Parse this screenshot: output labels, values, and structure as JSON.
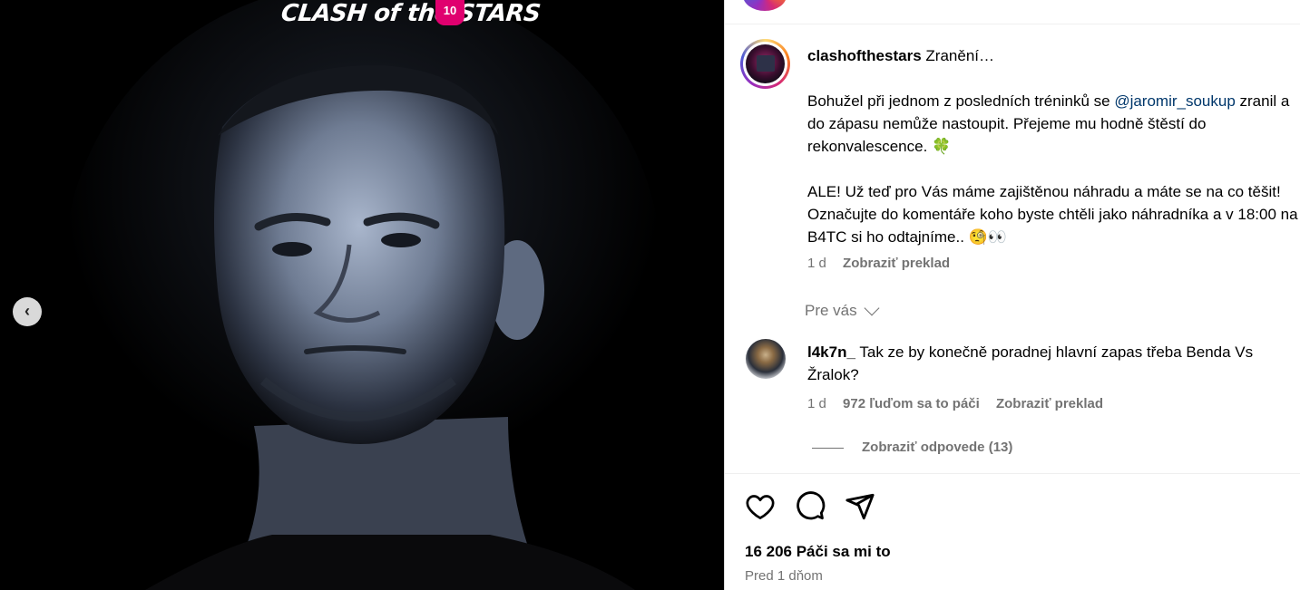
{
  "media": {
    "logo_text": "CLASH of the STARS",
    "logo_badge": "10",
    "prev_icon": "chevron-left-icon"
  },
  "post": {
    "username": "clashofthestars",
    "title": "Zranění…",
    "para1_a": "Bohužel při jednom z posledních tréninků se ",
    "mention": "@jaromir_soukup",
    "para1_b": " zranil a do zápasu nemůže nastoupit. Přejeme mu hodně štěstí do rekonvalescence. 🍀",
    "para2": "ALE! Už teď pro Vás máme zajištěnou náhradu a máte se na co těšit! Označujte do komentáře koho byste chtěli jako náhradníka a v 18:00 na B4TC si ho odtajníme.. 🧐👀",
    "age": "1 d",
    "translate": "Zobraziť preklad"
  },
  "filter": {
    "label": "Pre vás"
  },
  "comment": {
    "username": "l4k7n_",
    "text": "Tak ze by konečně poradnej hlavní zapas třeba Benda Vs Žralok?",
    "age": "1 d",
    "likes": "972 ľuďom sa to páči",
    "translate": "Zobraziť preklad",
    "replies": "Zobraziť odpovede (13)"
  },
  "actions": {
    "like_icon": "heart-icon",
    "comment_icon": "comment-icon",
    "share_icon": "share-icon"
  },
  "stats": {
    "likes": "16 206 Páči sa mi to",
    "time": "Pred 1 dňom"
  }
}
